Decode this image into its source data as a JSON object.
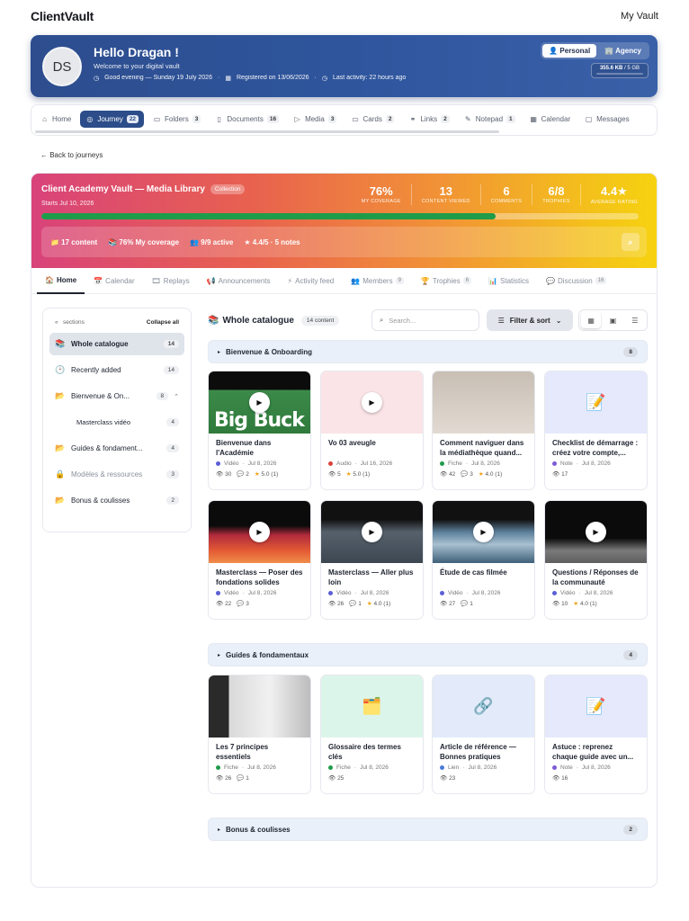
{
  "app": {
    "brand": "ClientVault",
    "my_vault": "My Vault"
  },
  "hero": {
    "initials": "DS",
    "greeting": "Hello Dragan !",
    "welcome": "Welcome to your digital vault",
    "meta": [
      "Good evening — Sunday 19 July 2026",
      "Registered on 13/06/2026",
      "Last activity: 22 hours ago"
    ],
    "mode_personal": "Personal",
    "mode_agency": "Agency",
    "storage_used": "355.6 KB",
    "storage_total": "/ 5 GB"
  },
  "tabs": [
    {
      "label": "Home",
      "icon": "home-icon",
      "glyph": "⌂"
    },
    {
      "label": "Journey",
      "count": "22",
      "icon": "journey-icon",
      "glyph": "◎",
      "active": true
    },
    {
      "label": "Folders",
      "count": "3",
      "icon": "folder-icon",
      "glyph": "▭"
    },
    {
      "label": "Documents",
      "count": "16",
      "icon": "document-icon",
      "glyph": "▯"
    },
    {
      "label": "Media",
      "count": "3",
      "icon": "media-icon",
      "glyph": "▷"
    },
    {
      "label": "Cards",
      "count": "2",
      "icon": "card-icon",
      "glyph": "▭"
    },
    {
      "label": "Links",
      "count": "2",
      "icon": "link-icon",
      "glyph": "⚭"
    },
    {
      "label": "Notepad",
      "count": "1",
      "icon": "notepad-icon",
      "glyph": "✎"
    },
    {
      "label": "Calendar",
      "icon": "calendar-icon",
      "glyph": "▦"
    },
    {
      "label": "Messages",
      "icon": "message-icon",
      "glyph": "▢"
    }
  ],
  "back_label": "← Back to journeys",
  "journey": {
    "title": "Client Academy Vault — Media Library",
    "badge": "Collection",
    "starts": "Starts Jul 10, 2026",
    "coverage_progress": 0.76,
    "stats": [
      {
        "value": "76%",
        "label": "My coverage"
      },
      {
        "value": "13",
        "label": "Content viewed"
      },
      {
        "value": "6",
        "label": "Comments"
      },
      {
        "value": "6/8",
        "label": "Trophies"
      },
      {
        "value": "4.4★",
        "label": "Average rating"
      }
    ],
    "strip": [
      "📁 17 content",
      "📚 76% My coverage",
      "👥 9/9 active",
      "★ 4.4/5 · 5 notes"
    ]
  },
  "subtabs": [
    {
      "label": "Home",
      "glyph": "🏠",
      "active": true
    },
    {
      "label": "Calendar",
      "glyph": "📅"
    },
    {
      "label": "Replays",
      "glyph": "🎞"
    },
    {
      "label": "Announcements",
      "glyph": "📢"
    },
    {
      "label": "Activity feed",
      "glyph": "⚡"
    },
    {
      "label": "Members",
      "glyph": "👥",
      "count": "9"
    },
    {
      "label": "Trophies",
      "glyph": "🏆",
      "count": "6"
    },
    {
      "label": "Statistics",
      "glyph": "📊"
    },
    {
      "label": "Discussion",
      "glyph": "💬",
      "count": "16"
    }
  ],
  "sidebar": {
    "sections_label": "sections",
    "collapse_label": "Collapse all",
    "items": [
      {
        "label": "Whole catalogue",
        "count": "14",
        "glyph": "📚",
        "active": true
      },
      {
        "label": "Recently added",
        "count": "14",
        "glyph": "🕑"
      },
      {
        "label": "Bienvenue & On...",
        "count": "8",
        "glyph": "📂",
        "expanded": true
      },
      {
        "label": "Masterclass vidéo",
        "count": "4",
        "sub": true
      },
      {
        "label": "Guides & fondament...",
        "count": "4",
        "glyph": "📂"
      },
      {
        "label": "Modèles & ressources",
        "count": "3",
        "glyph": "🔒",
        "muted": true
      },
      {
        "label": "Bonus & coulisses",
        "count": "2",
        "glyph": "📂"
      }
    ]
  },
  "catalogue": {
    "title": "Whole catalogue",
    "count": "14 content",
    "search_placeholder": "Search...",
    "filter_label": "Filter & sort"
  },
  "sections": [
    {
      "label": "Bienvenue & Onboarding",
      "count": "8"
    },
    {
      "label": "Guides & fondamentaux",
      "count": "4"
    },
    {
      "label": "Bonus & coulisses",
      "count": "2"
    }
  ],
  "cards": [
    {
      "title": "Bienvenue dans l'Académie",
      "type": "Vidéo",
      "date": "Jul 8, 2026",
      "views": "30",
      "comments": "2",
      "rating": "5.0 (1)",
      "thumb": "bigbuck",
      "play": true,
      "dot": "#5b5fd6"
    },
    {
      "title": "Vo 03 aveugle",
      "type": "Audio",
      "date": "Jul 16, 2026",
      "views": "5",
      "rating": "5.0 (1)",
      "thumb": "pink",
      "play": true,
      "dot": "#d9423c"
    },
    {
      "title": "Comment naviguer dans la médiathèque quand...",
      "type": "Fiche",
      "date": "Jul 8, 2026",
      "views": "42",
      "comments": "3",
      "rating": "4.0 (1)",
      "thumb": "beige",
      "dot": "#1f9c4a"
    },
    {
      "title": "Checklist de démarrage : créez votre compte,...",
      "type": "Note",
      "date": "Jul 8, 2026",
      "views": "17",
      "thumb": "lavender",
      "emoji": "📝",
      "dot": "#7c5cd6"
    },
    {
      "title": "Masterclass — Poser des fondations solides",
      "type": "Vidéo",
      "date": "Jul 8, 2026",
      "views": "22",
      "comments": "3",
      "thumb": "sunset",
      "play": true,
      "dot": "#5b5fd6"
    },
    {
      "title": "Masterclass — Aller plus loin",
      "type": "Vidéo",
      "date": "Jul 8, 2026",
      "views": "26",
      "comments": "1",
      "rating": "4.0 (1)",
      "thumb": "stone",
      "play": true,
      "dot": "#5b5fd6"
    },
    {
      "title": "Étude de cas filmée",
      "type": "Vidéo",
      "date": "Jul 8, 2026",
      "views": "27",
      "comments": "1",
      "thumb": "water",
      "play": true,
      "dot": "#5b5fd6"
    },
    {
      "title": "Questions / Réponses de la communauté",
      "type": "Vidéo",
      "date": "Jul 8, 2026",
      "views": "10",
      "rating": "4.0 (1)",
      "thumb": "grey",
      "play": true,
      "dot": "#5b5fd6"
    },
    {
      "title": "Les 7 principes essentiels",
      "type": "Fiche",
      "date": "Jul 8, 2026",
      "views": "26",
      "comments": "1",
      "thumb": "office",
      "dot": "#1f9c4a"
    },
    {
      "title": "Glossaire des termes clés",
      "type": "Fiche",
      "date": "Jul 8, 2026",
      "views": "25",
      "thumb": "mint",
      "emoji": "🗂️",
      "dot": "#1f9c4a"
    },
    {
      "title": "Article de référence — Bonnes pratiques",
      "type": "Lien",
      "date": "Jul 8, 2026",
      "views": "23",
      "thumb": "sky",
      "emoji": "🔗",
      "dot": "#4a7bd9"
    },
    {
      "title": "Astuce : reprenez chaque guide avec un...",
      "type": "Note",
      "date": "Jul 8, 2026",
      "views": "16",
      "thumb": "lavender",
      "emoji": "📝",
      "dot": "#7c5cd6"
    }
  ]
}
